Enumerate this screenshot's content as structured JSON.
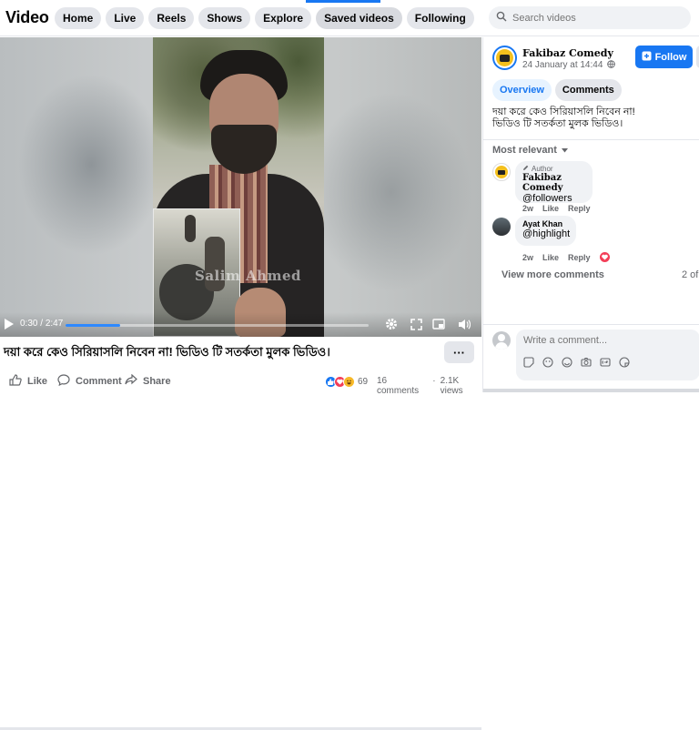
{
  "header": {
    "title": "Video",
    "tabs": [
      {
        "label": "Home"
      },
      {
        "label": "Live"
      },
      {
        "label": "Reels"
      },
      {
        "label": "Shows"
      },
      {
        "label": "Explore"
      },
      {
        "label": "Saved videos",
        "active": true
      },
      {
        "label": "Following"
      }
    ],
    "search_placeholder": "Search videos"
  },
  "player": {
    "time_current": "0:30",
    "time_sep": " / ",
    "time_total": "2:47",
    "progress": 0.18,
    "watermark": "Salim Ahmed"
  },
  "post": {
    "caption": "দয়া করে কেও সিরিয়াসলি নিবেন না! ভিডিও টি সতর্কতা মুলক ভিডিও।",
    "more_label": "···",
    "like_label": "Like",
    "comment_label": "Comment",
    "share_label": "Share",
    "reaction_count": "69",
    "comments_count": "16 comments",
    "views_count": "2.1K views"
  },
  "panel": {
    "page_name": "Fakibaz Comedy",
    "date": "24 January at 14:44",
    "follow_label": "Follow",
    "tabs": [
      {
        "label": "Overview",
        "selected": true
      },
      {
        "label": "Comments"
      }
    ],
    "description_line1": "দয়া করে কেও সিরিয়াসলি নিবেন না!",
    "description_line2": "ভিডিও টি সতর্কতা মুলক ভিডিও।",
    "sort_label": "Most relevant",
    "comments": [
      {
        "badge": "Author",
        "name": "Fakibaz Comedy",
        "text": "@followers",
        "age": "2w",
        "like": "Like",
        "reply": "Reply"
      },
      {
        "name": "Ayat Khan",
        "text": "@highlight",
        "age": "2w",
        "like": "Like",
        "reply": "Reply",
        "reaction": "heart"
      }
    ],
    "view_more": "View more comments",
    "page_count": "2 of",
    "composer_placeholder": "Write a comment..."
  },
  "colors": {
    "accent": "#1877f2",
    "progress": "#2e89ff",
    "heart": "#f33e58"
  }
}
